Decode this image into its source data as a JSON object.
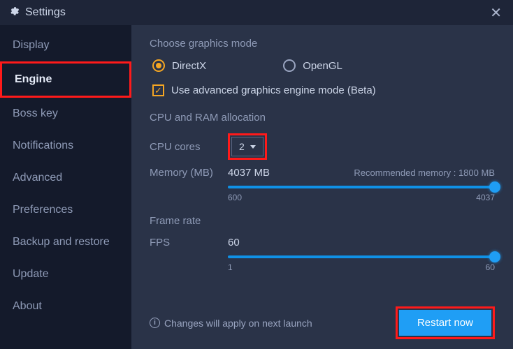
{
  "titlebar": {
    "title": "Settings"
  },
  "sidebar": {
    "items": [
      {
        "label": "Display"
      },
      {
        "label": "Engine"
      },
      {
        "label": "Boss key"
      },
      {
        "label": "Notifications"
      },
      {
        "label": "Advanced"
      },
      {
        "label": "Preferences"
      },
      {
        "label": "Backup and restore"
      },
      {
        "label": "Update"
      },
      {
        "label": "About"
      }
    ],
    "active_index": 1
  },
  "sections": {
    "graphics": {
      "title": "Choose graphics mode",
      "options": [
        {
          "label": "DirectX",
          "selected": true
        },
        {
          "label": "OpenGL",
          "selected": false
        }
      ],
      "advanced_checkbox": {
        "label": "Use advanced graphics engine mode (Beta)",
        "checked": true
      }
    },
    "allocation": {
      "title": "CPU and RAM allocation",
      "cpu_label": "CPU cores",
      "cpu_value": "2",
      "memory_label": "Memory (MB)",
      "memory_value": "4037 MB",
      "recommended": "Recommended memory : 1800 MB",
      "slider_min": "600",
      "slider_max": "4037"
    },
    "frame": {
      "title": "Frame rate",
      "fps_label": "FPS",
      "fps_value": "60",
      "slider_min": "1",
      "slider_max": "60"
    }
  },
  "footer": {
    "note": "Changes will apply on next launch",
    "button": "Restart now"
  }
}
